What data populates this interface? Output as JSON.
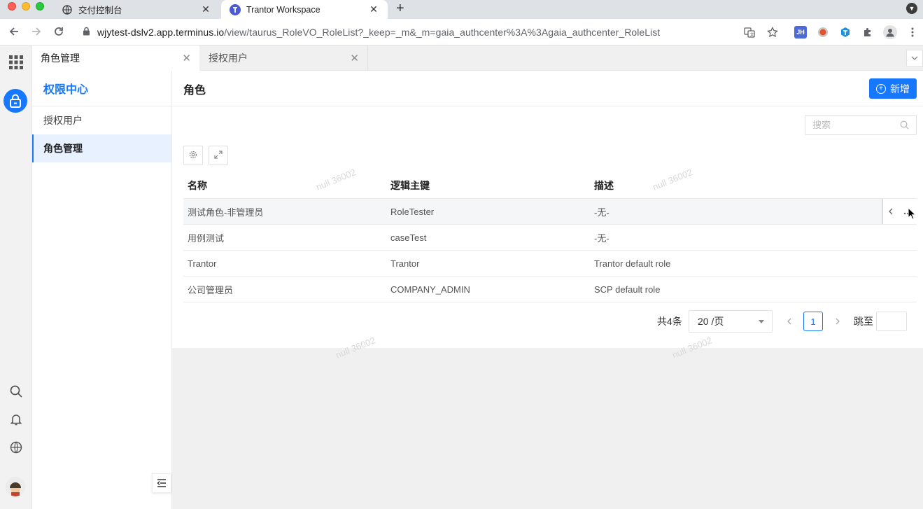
{
  "browser": {
    "tabs": [
      {
        "title": "交付控制台"
      },
      {
        "title": "Trantor Workspace"
      }
    ],
    "url_host": "wjytest-dslv2.app.terminus.io",
    "url_path": "/view/taurus_RoleVO_RoleList?_keep=_m&_m=gaia_authcenter%3A%3Agaia_authcenter_RoleList",
    "extension_badge": "JH"
  },
  "app_tabs": [
    {
      "label": "角色管理"
    },
    {
      "label": "授权用户"
    }
  ],
  "sidebar": {
    "title": "权限中心",
    "items": [
      {
        "label": "授权用户",
        "active": false
      },
      {
        "label": "角色管理",
        "active": true
      }
    ]
  },
  "page": {
    "title": "角色",
    "add_label": "新增",
    "search_placeholder": "搜索"
  },
  "table": {
    "columns": [
      "名称",
      "逻辑主键",
      "描述"
    ],
    "rows": [
      [
        "测试角色-非管理员",
        "RoleTester",
        "-无-"
      ],
      [
        "用例测试",
        "caseTest",
        "-无-"
      ],
      [
        "Trantor",
        "Trantor",
        "Trantor default role"
      ],
      [
        "公司管理员",
        "COMPANY_ADMIN",
        "SCP default role"
      ]
    ]
  },
  "pagination": {
    "total": "共4条",
    "page_size": "20 /页",
    "current_page": "1",
    "jump_label": "跳至"
  },
  "watermark": "null 36002",
  "colors": {
    "accent": "#1677ff",
    "rail_icon": "#1677ff"
  }
}
